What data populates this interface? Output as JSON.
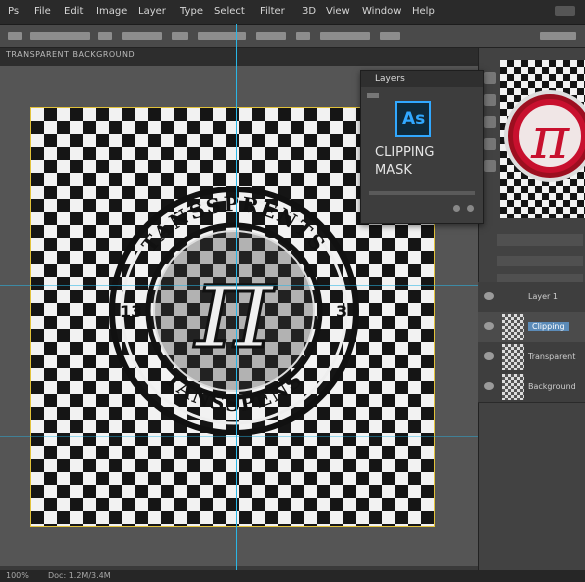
{
  "menubar": {
    "items": [
      "Ps",
      "File",
      "Edit",
      "Image",
      "Layer",
      "Type",
      "Select",
      "Filter",
      "3D",
      "View",
      "Window",
      "Help"
    ]
  },
  "ruler": {
    "label": "TRANSPARENT BACKGROUND"
  },
  "artwork": {
    "top_text": "TANSSPRENTS",
    "bottom_text": "TANSSPENS",
    "left_number": "13",
    "right_number": "3",
    "center_glyph": "π",
    "colors": {
      "ring": "#111111",
      "glyph": "#f0f0f0",
      "accent": "#29b6e6"
    }
  },
  "panel": {
    "title": "Layers",
    "app_badge": "As",
    "line1": "CLIPPING",
    "line2": "MASK"
  },
  "preview": {
    "glyph": "π",
    "colors": {
      "badge": "#c8102e"
    }
  },
  "layers": [
    {
      "name": "Layer 1",
      "selected": false
    },
    {
      "name": "Clipping",
      "selected": true
    },
    {
      "name": "Transparent",
      "selected": false
    },
    {
      "name": "Background",
      "selected": false
    }
  ],
  "status": {
    "zoom": "100%",
    "doc": "Doc: 1.2M/3.4M"
  }
}
